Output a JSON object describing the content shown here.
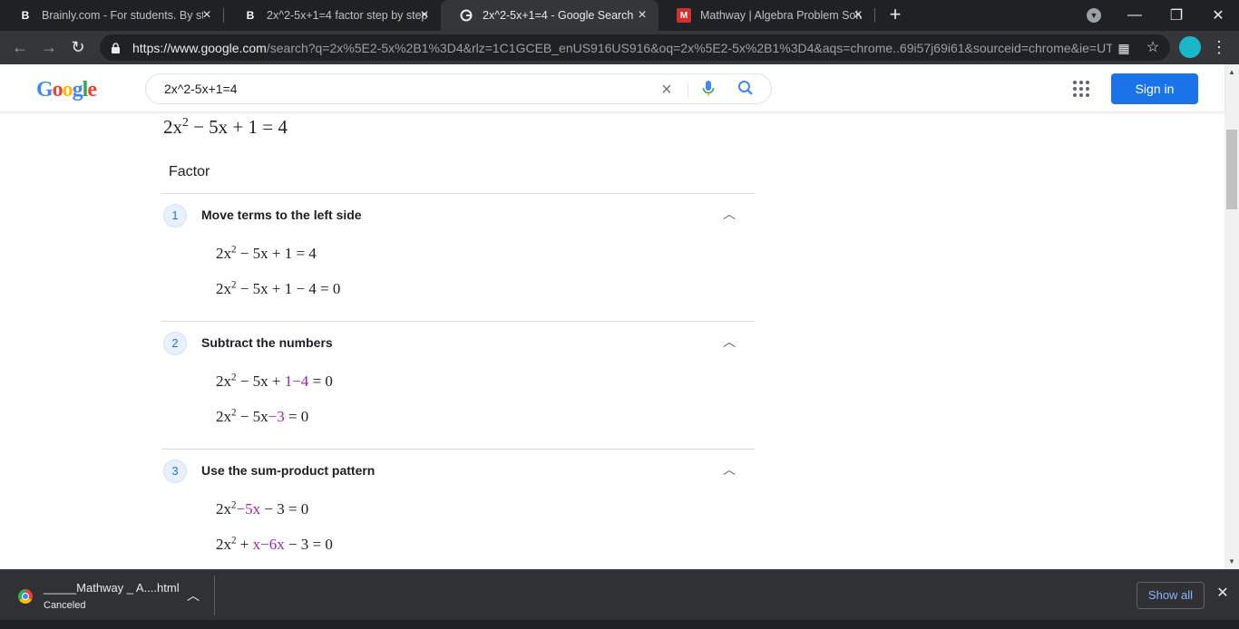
{
  "browser": {
    "tabs": [
      {
        "title": "Brainly.com - For students. By stu",
        "favicon": "B",
        "active": false
      },
      {
        "title": "2x^2-5x+1=4 factor step by step",
        "favicon": "B",
        "active": false
      },
      {
        "title": "2x^2-5x+1=4 - Google Search",
        "favicon": "G",
        "active": true
      },
      {
        "title": "Mathway | Algebra Problem Solv",
        "favicon": "M",
        "active": false
      }
    ],
    "new_tab": "+",
    "url_main": "https://www.google.com",
    "url_rest": "/search?q=2x%5E2-5x%2B1%3D4&rlz=1C1GCEB_enUS916US916&oq=2x%5E2-5x%2B1%3D4&aqs=chrome..69i57j69i61&sourceid=chrome&ie=UT..."
  },
  "header": {
    "logo": "Google",
    "search_value": "2x^2-5x+1=4",
    "sign_in": "Sign in"
  },
  "solution": {
    "main_equation": {
      "a": "2x",
      "exp": "2",
      "b": " − 5x + 1 = 4"
    },
    "method": "Factor",
    "steps": [
      {
        "number": "1",
        "title": "Move terms to the left side",
        "eq1": {
          "a": "2x",
          "exp": "2",
          "b": " − 5x + 1 = 4"
        },
        "eq2": {
          "a": "2x",
          "exp": "2",
          "b": " − 5x + 1 − 4 = 0"
        }
      },
      {
        "number": "2",
        "title": "Subtract the numbers",
        "eq1": {
          "a": "2x",
          "exp": "2",
          "b": " − 5x + ",
          "hl": "1−4",
          "c": " = 0"
        },
        "eq2": {
          "a": "2x",
          "exp": "2",
          "b": " − 5x",
          "hl": "−3",
          "c": " = 0"
        }
      },
      {
        "number": "3",
        "title": "Use the sum-product pattern",
        "eq1": {
          "a": "2x",
          "exp": "2",
          "b": "",
          "hl": "−5x",
          "c": " − 3 = 0"
        },
        "eq2": {
          "a": "2x",
          "exp": "2",
          "b": " + ",
          "hl": "x−6x",
          "c": " − 3 = 0"
        }
      }
    ]
  },
  "download": {
    "file_name": "_____Mathway _ A....html",
    "status": "Canceled",
    "show_all": "Show all"
  }
}
